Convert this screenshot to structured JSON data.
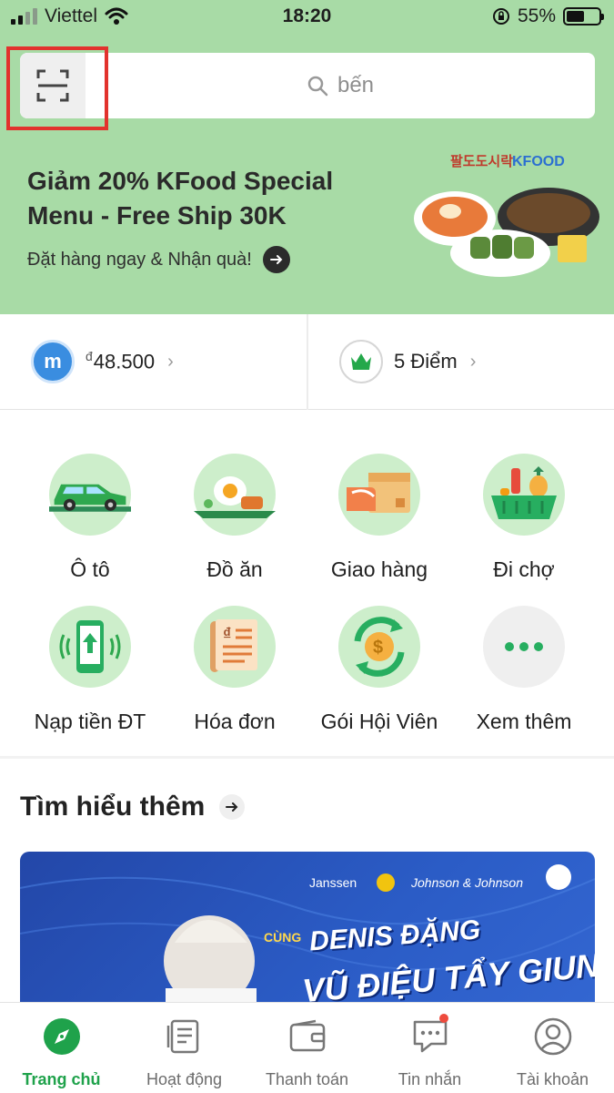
{
  "status_bar": {
    "carrier": "Viettel",
    "time": "18:20",
    "battery": "55%"
  },
  "search": {
    "placeholder": "bến"
  },
  "promo": {
    "title": "Giảm 20% KFood Special Menu - Free Ship 30K",
    "subtitle": "Đặt hàng ngay & Nhận quà!",
    "brand": "KFOOD"
  },
  "wallet": {
    "avatar_letter": "m",
    "currency_symbol": "đ",
    "balance": "48.500",
    "points": "5 Điểm"
  },
  "services": [
    {
      "label": "Ô tô",
      "icon": "car-icon"
    },
    {
      "label": "Đồ ăn",
      "icon": "food-icon"
    },
    {
      "label": "Giao hàng",
      "icon": "delivery-box-icon"
    },
    {
      "label": "Đi chợ",
      "icon": "grocery-basket-icon"
    },
    {
      "label": "Nạp tiền ĐT",
      "icon": "phone-topup-icon"
    },
    {
      "label": "Hóa đơn",
      "icon": "bill-icon"
    },
    {
      "label": "Gói Hội Viên",
      "icon": "membership-coin-icon"
    },
    {
      "label": "Xem thêm",
      "icon": "more-dots-icon"
    }
  ],
  "learn_more": {
    "title": "Tìm hiểu thêm",
    "banner": {
      "brand1": "Janssen",
      "brand2": "Johnson & Johnson",
      "prefix": "CÙNG",
      "line1": "DENIS ĐẶNG",
      "line2": "VŨ ĐIỆU TẨY GIUN"
    }
  },
  "tabs": [
    {
      "label": "Trang chủ",
      "icon": "compass-icon",
      "active": true
    },
    {
      "label": "Hoạt động",
      "icon": "activity-list-icon",
      "active": false
    },
    {
      "label": "Thanh toán",
      "icon": "wallet-icon",
      "active": false
    },
    {
      "label": "Tin nhắn",
      "icon": "chat-icon",
      "active": false,
      "badge": true
    },
    {
      "label": "Tài khoản",
      "icon": "account-icon",
      "active": false
    }
  ],
  "colors": {
    "header_green": "#a8dba6",
    "service_circle": "#cdeecb",
    "active_green": "#1fa24b",
    "highlight_red": "#e2322d",
    "avatar_blue": "#3a8de0",
    "banner_blue": "#2b5cc6"
  }
}
